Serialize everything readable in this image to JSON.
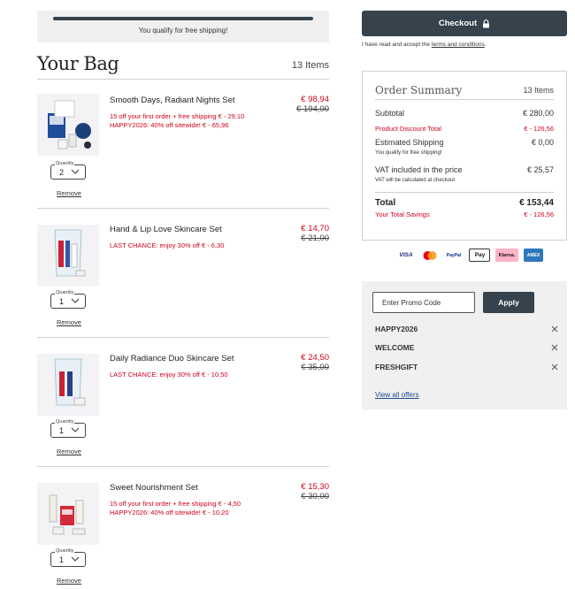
{
  "shipping": {
    "message": "You qualify for free shipping!",
    "progress_fraction": 1.0
  },
  "bag": {
    "title": "Your Bag",
    "count": "13 Items"
  },
  "items": [
    {
      "name": "Smooth Days, Radiant Nights Set",
      "promos": [
        "15 off your first order + free shipping € - 29,10",
        "HAPPY2026: 40% off sitewide! € - 65,96"
      ],
      "price": "€ 98,94",
      "old_price": "€ 194,00",
      "quantity_label": "Quantity",
      "quantity": "2",
      "remove_label": "Remove"
    },
    {
      "name": "Hand & Lip Love Skincare Set",
      "promos": [
        "LAST CHANCE: enjoy 30% off € - 6,30"
      ],
      "price": "€ 14,70",
      "old_price": "€ 21,00",
      "quantity_label": "Quantity",
      "quantity": "1",
      "remove_label": "Remove"
    },
    {
      "name": "Daily Radiance Duo Skincare Set",
      "promos": [
        "LAST CHANCE: enjoy 30% off € - 10,50"
      ],
      "price": "€ 24,50",
      "old_price": "€ 35,00",
      "quantity_label": "Quantity",
      "quantity": "1",
      "remove_label": "Remove"
    },
    {
      "name": "Sweet Nourishment Set",
      "promos": [
        "15 off your first order + free shipping € - 4,50",
        "HAPPY2026: 40% off sitewide! € - 10,20"
      ],
      "price": "€ 15,30",
      "old_price": "€ 30,00",
      "quantity_label": "Quantity",
      "quantity": "1",
      "remove_label": "Remove"
    }
  ],
  "checkout": {
    "button_label": "Checkout",
    "lock_icon": "lock-icon",
    "terms_prefix": "I have read and accept the ",
    "terms_link": "terms and conditions",
    "terms_suffix": "."
  },
  "summary": {
    "title": "Order Summary",
    "count": "13 Items",
    "subtotal_label": "Subtotal",
    "subtotal": "€ 280,00",
    "discount_label": "Product Discount Total",
    "discount": "€ - 126,56",
    "shipping_label": "Estimated Shipping",
    "shipping": "€ 0,00",
    "shipping_note": "You qualify for free shipping!",
    "vat_label": "VAT included in the price",
    "vat": "€ 25,57",
    "vat_note": "VAT will be calculated at checkout",
    "total_label": "Total",
    "total": "€ 153,44",
    "savings_label": "Your Total Savings",
    "savings": "€ - 126,56"
  },
  "payment_methods": [
    {
      "name": "VISA",
      "icon": "visa-icon"
    },
    {
      "name": "",
      "icon": "mastercard-icon"
    },
    {
      "name": "PayPal",
      "icon": "paypal-icon"
    },
    {
      "name": "Pay",
      "icon": "apple-pay-icon"
    },
    {
      "name": "Klarna.",
      "icon": "klarna-icon"
    },
    {
      "name": "AMEX",
      "icon": "amex-icon"
    }
  ],
  "promo": {
    "placeholder": "Enter Promo Code",
    "apply_label": "Apply",
    "codes": [
      "HAPPY2026",
      "WELCOME",
      "FRESHGIFT"
    ],
    "view_all": "View all offers"
  },
  "colors": {
    "accent": "#36424c",
    "discount_red": "#d0021b",
    "panel_grey": "#f0f0f0"
  }
}
